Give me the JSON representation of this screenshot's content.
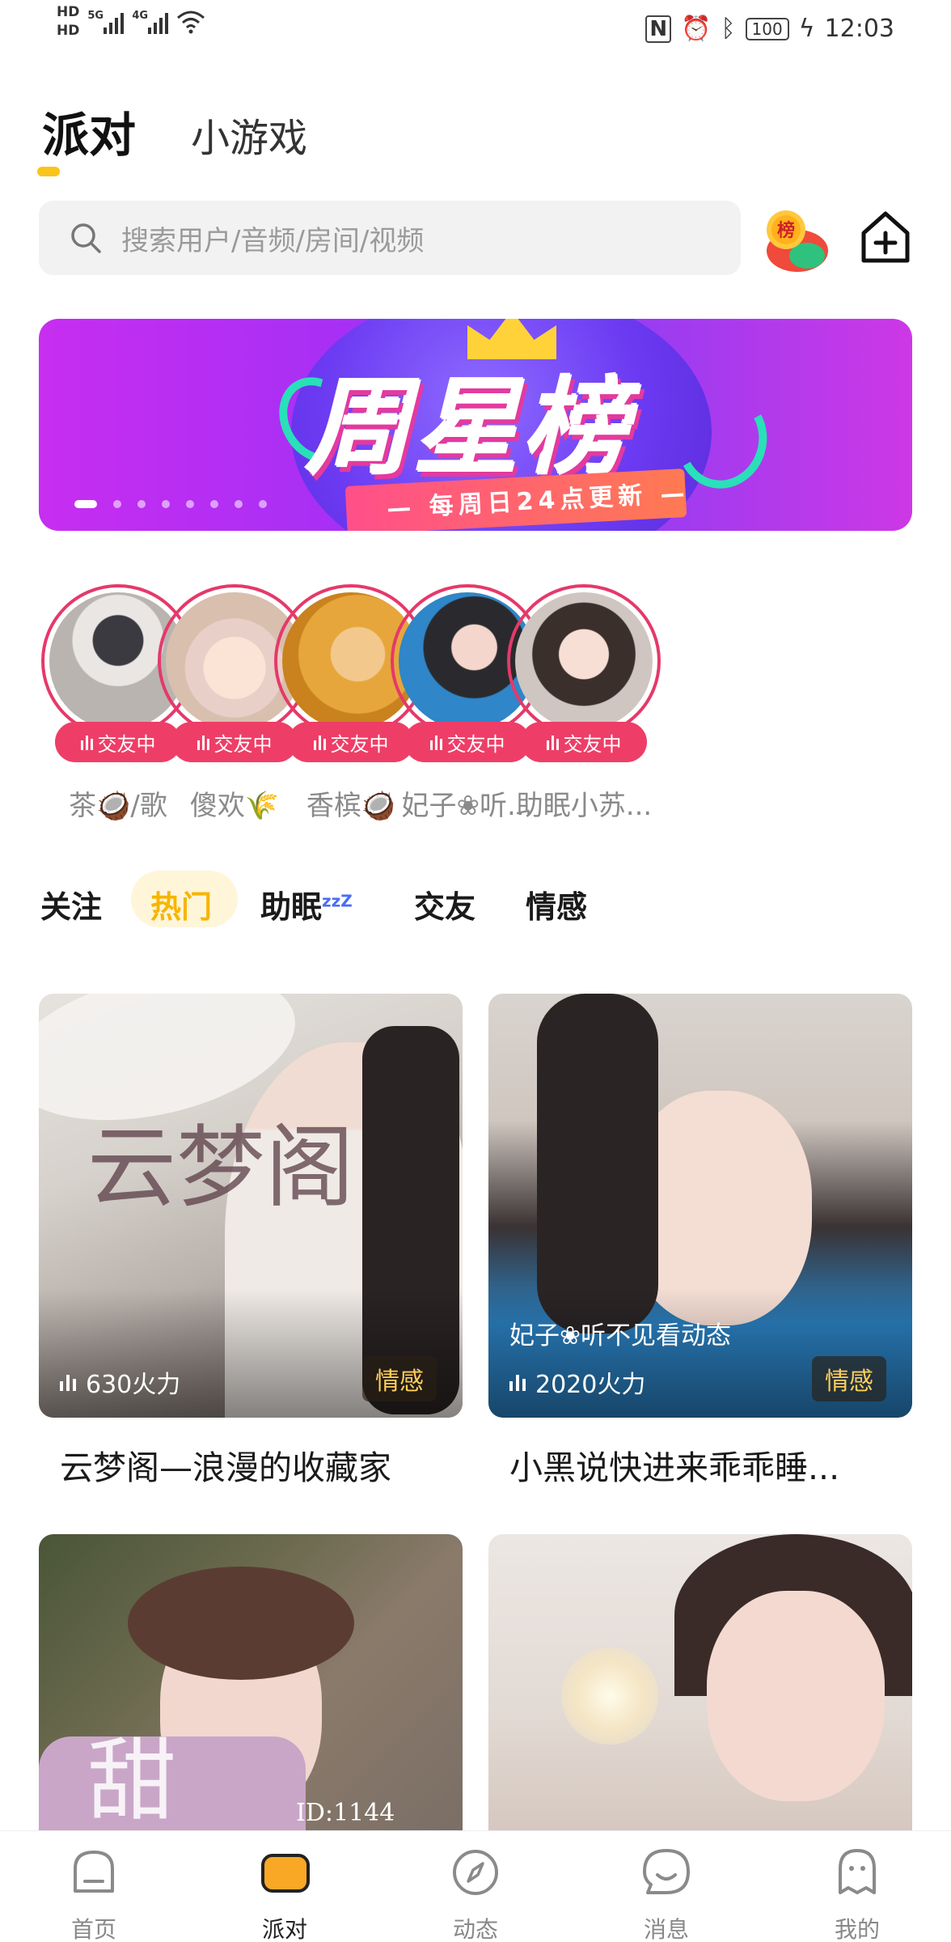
{
  "status_bar": {
    "hd1": "HD",
    "hd2": "HD",
    "sim1": "5G",
    "sim2": "4G",
    "battery": "100",
    "time": "12:03"
  },
  "header": {
    "tab_party": "派对",
    "tab_games": "小游戏"
  },
  "search": {
    "placeholder": "搜索用户/音频/房间/视频"
  },
  "rank_badge": "榜",
  "banner": {
    "title": "周星榜",
    "subtitle": "— 每周日24点更新 —",
    "page_count": 8,
    "current_page": 1
  },
  "live_users": [
    {
      "name": "茶🥥/歌",
      "status": "交友中"
    },
    {
      "name": "傻欢🌾",
      "status": "交友中"
    },
    {
      "name": "香槟🥥",
      "status": "交友中"
    },
    {
      "name": "妃子❀听...",
      "status": "交友中"
    },
    {
      "name": "助眠小苏...",
      "status": "交友中"
    }
  ],
  "category_tabs": [
    {
      "label": "关注",
      "active": false
    },
    {
      "label": "热门",
      "active": true
    },
    {
      "label": "助眠",
      "active": false
    },
    {
      "label": "交友",
      "active": false
    },
    {
      "label": "情感",
      "active": false
    }
  ],
  "zzz": "zzZ",
  "rooms": [
    {
      "title": "云梦阁—浪漫的收藏家",
      "heat": "630火力",
      "tag": "情感",
      "art_text": "云梦阁"
    },
    {
      "title": "小黑说快进来乖乖睡...",
      "heat": "2020火力",
      "tag": "情感",
      "owner": "妃子❀听不见看动态"
    },
    {
      "title": "",
      "art_text": "甜",
      "room_id": "ID:1144"
    },
    {
      "title": ""
    }
  ],
  "bottom_nav": [
    {
      "label": "首页",
      "active": false
    },
    {
      "label": "派对",
      "active": true
    },
    {
      "label": "动态",
      "active": false
    },
    {
      "label": "消息",
      "active": false
    },
    {
      "label": "我的",
      "active": false
    }
  ],
  "colors": {
    "accent_yellow": "#f9c51b",
    "live_pink": "#ee3e67",
    "tag_text": "#ffcf5a"
  }
}
